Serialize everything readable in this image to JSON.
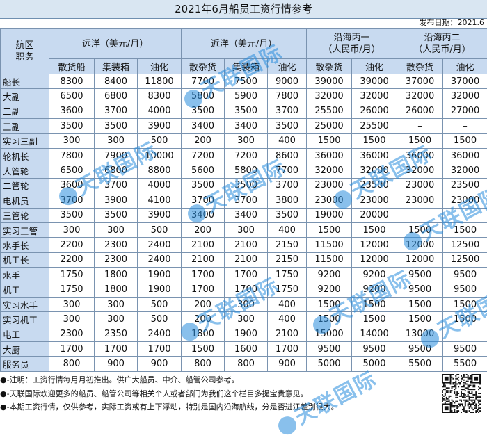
{
  "title": "2021年6月船员工资行情参考",
  "date_label": "发布日期：2021.6",
  "header": {
    "corner_top": "航区",
    "corner_bottom": "职务",
    "groups": [
      "远洋（美元/月）",
      "近洋（美元/月）",
      "沿海丙一\n（人民币/月）",
      "沿海丙二\n（人民币/月）"
    ],
    "sub": [
      "散货船",
      "集装箱",
      "油化",
      "散杂货",
      "集装箱",
      "油化",
      "散杂货",
      "油化",
      "散杂货",
      "油化"
    ]
  },
  "rows": [
    {
      "rank": "船长",
      "v": [
        "8300",
        "8400",
        "11800",
        "7700",
        "7500",
        "9000",
        "39000",
        "39000",
        "37000",
        "37000"
      ]
    },
    {
      "rank": "大副",
      "v": [
        "6500",
        "6800",
        "8300",
        "5800",
        "5900",
        "7800",
        "32000",
        "32000",
        "32000",
        "32000"
      ]
    },
    {
      "rank": "二副",
      "v": [
        "3600",
        "3700",
        "4000",
        "3500",
        "3500",
        "3700",
        "25500",
        "26000",
        "26000",
        "27000"
      ]
    },
    {
      "rank": "三副",
      "v": [
        "3500",
        "3500",
        "3900",
        "3400",
        "3400",
        "3500",
        "25000",
        "25500",
        "–",
        "–"
      ]
    },
    {
      "rank": "实习三副",
      "v": [
        "300",
        "300",
        "500",
        "200",
        "300",
        "400",
        "1500",
        "1500",
        "1500",
        "1500"
      ]
    },
    {
      "rank": "轮机长",
      "v": [
        "7800",
        "7900",
        "10000",
        "7200",
        "7200",
        "8600",
        "36000",
        "36000",
        "36000",
        "36000"
      ]
    },
    {
      "rank": "大管轮",
      "v": [
        "6500",
        "6800",
        "8800",
        "5600",
        "5800",
        "7700",
        "32000",
        "32000",
        "32000",
        "32000"
      ]
    },
    {
      "rank": "二管轮",
      "v": [
        "3600",
        "3700",
        "4000",
        "3500",
        "3500",
        "3700",
        "23000",
        "23500",
        "23000",
        "23500"
      ]
    },
    {
      "rank": "电机员",
      "v": [
        "3700",
        "3900",
        "4100",
        "3700",
        "3700",
        "3800",
        "23000",
        "23000",
        "23000",
        "23000"
      ]
    },
    {
      "rank": "三管轮",
      "v": [
        "3500",
        "3500",
        "3900",
        "3400",
        "3400",
        "3500",
        "19000",
        "20000",
        "–",
        "–"
      ]
    },
    {
      "rank": "实习三管",
      "v": [
        "300",
        "300",
        "500",
        "200",
        "300",
        "400",
        "1500",
        "1500",
        "1500",
        "1500"
      ]
    },
    {
      "rank": "水手长",
      "v": [
        "2200",
        "2300",
        "2400",
        "2100",
        "2100",
        "2150",
        "11500",
        "12000",
        "12000",
        "12500"
      ]
    },
    {
      "rank": "机工长",
      "v": [
        "2200",
        "2300",
        "2400",
        "2100",
        "2100",
        "2150",
        "11500",
        "12000",
        "12000",
        "12500"
      ]
    },
    {
      "rank": "水手",
      "v": [
        "1750",
        "1800",
        "1900",
        "1700",
        "1700",
        "1750",
        "9200",
        "9200",
        "9500",
        "9500"
      ]
    },
    {
      "rank": "机工",
      "v": [
        "1750",
        "1800",
        "1900",
        "1700",
        "1700",
        "1750",
        "9200",
        "9200",
        "9500",
        "9500"
      ]
    },
    {
      "rank": "实习水手",
      "v": [
        "300",
        "300",
        "500",
        "200",
        "300",
        "400",
        "1500",
        "1500",
        "1500",
        "1500"
      ]
    },
    {
      "rank": "实习机工",
      "v": [
        "300",
        "300",
        "500",
        "200",
        "300",
        "400",
        "1500",
        "1500",
        "1500",
        "1500"
      ]
    },
    {
      "rank": "电工",
      "v": [
        "2300",
        "2350",
        "2400",
        "1800",
        "1900",
        "2100",
        "15000",
        "14000",
        "13000",
        "–"
      ]
    },
    {
      "rank": "大厨",
      "v": [
        "1700",
        "1700",
        "1700",
        "1500",
        "1600",
        "1700",
        "9500",
        "9500",
        "9500",
        "9500"
      ]
    },
    {
      "rank": "服务员",
      "v": [
        "800",
        "900",
        "900",
        "800",
        "800",
        "900",
        "5000",
        "5000",
        "5500",
        "5500"
      ]
    }
  ],
  "notes": [
    "●-注明：工资行情每月月初推出。供广大船员、中介、船管公司参考。",
    "●-天联国际欢迎更多的船员、船管公司等相关个人或者部门为我们这个栏目多提宝贵意见。",
    "●-本期工资行情，仅供参考，实际工资或有上下浮动，特别是国内沿海航线，分是否进江差别很大。"
  ],
  "watermark": "天联国际",
  "colors": {
    "header_bg": "#c8daf0",
    "title_bg": "#d9e6f2",
    "border": "#7a93b0",
    "watermark": "#288cdc"
  }
}
